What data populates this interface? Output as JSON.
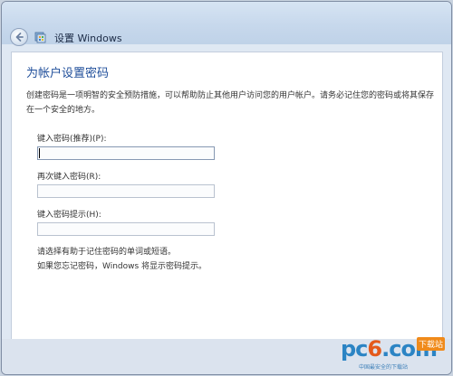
{
  "window": {
    "title": "设置 Windows"
  },
  "page": {
    "heading": "为帐户设置密码",
    "description": "创建密码是一项明智的安全预防措施，可以帮助防止其他用户访问您的用户帐户。请务必记住您的密码或将其保存在一个安全的地方。"
  },
  "form": {
    "password_label": "键入密码(推荐)(P):",
    "password_value": "",
    "confirm_label": "再次键入密码(R):",
    "confirm_value": "",
    "hint_label": "键入密码提示(H):",
    "hint_value": ""
  },
  "help": {
    "line1": "请选择有助于记住密码的单词或短语。",
    "line2": "如果您忘记密码，Windows 将显示密码提示。"
  },
  "watermark": {
    "brand_pre": "pc",
    "brand_six": "6",
    "brand_post": ".com",
    "tag": "下载站",
    "sub": "中国最安全的下载站"
  },
  "icons": {
    "back": "back-arrow-icon",
    "app": "windows-setup-icon"
  },
  "colors": {
    "heading": "#1f4e9a",
    "titlebar": "#c7d8ec",
    "footer": "#dbe3ee"
  }
}
